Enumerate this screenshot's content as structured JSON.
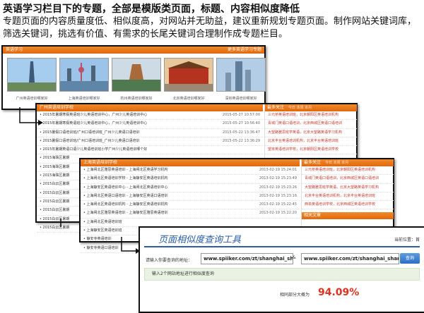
{
  "heading": "英语学习栏目下的专题，全部是模版类页面，标题、内容相似度降低",
  "description": "专题页面的内容质量度低、相似度高，对网站并无助益，建议重新规划专题页面。制作网站关键词库，筛选关键词，挑选有价值、有需求的长尾关键词合理制作成专题栏目。",
  "panel1": {
    "header": "英语学习",
    "more": "更多英语学习专题",
    "thumbs": [
      {
        "caption": "广州英语培训哪家好",
        "icon": "thumb-tower",
        "color": "#6aa8d8"
      },
      {
        "caption": "上海英语培训哪家好",
        "icon": "thumb-shanghai",
        "color": "#8ab6e0"
      },
      {
        "caption": "杭州英语培训哪家好",
        "icon": "thumb-pagoda",
        "color": "#9fb7cf"
      },
      {
        "caption": "北京英语培训哪家好",
        "icon": "thumb-tiananmen",
        "color": "#c24b2b"
      },
      {
        "caption": "深圳英语培训哪家好",
        "icon": "thumb-skyline",
        "color": "#7fa3c9"
      }
    ]
  },
  "panel2": {
    "header": "广州英语培训学校",
    "items": [
      {
        "text": "• 2015年暑期寒假英语班少儿英语培训中心，广州少儿英语培训中心",
        "date": "2015-05-27 10:57:00"
      },
      {
        "text": "• 2015年暑期寒假英语班少儿英语培训中心，广州少儿英语培训中心",
        "date": "2015-05-27 10:56:40"
      },
      {
        "text": "• 2015暑假口语培训班/广州口语培训班_广州少儿英语口语培训",
        "date": "2015-05-22 13:36:47"
      },
      {
        "text": "• 2015暑假口语培训班/广州口语培训班_广州少儿英语口语培训",
        "date": "2015-05-22 13:36:29"
      },
      {
        "text": "• 2015年暑期英语口语少儿英语培训班小学广州少儿英语培训哪个好",
        "date": ""
      },
      {
        "text": "• 2015海珠区暑期",
        "date": ""
      },
      {
        "text": "• 2015海珠区暑期",
        "date": ""
      },
      {
        "text": "• 2015海珠区暑期",
        "date": ""
      },
      {
        "text": "• 2015白云区暑期",
        "date": ""
      },
      {
        "text": "• 2015白云区暑期",
        "date": ""
      },
      {
        "text": "• 2015白云区暑期",
        "date": ""
      },
      {
        "text": "• 2015白云区暑期",
        "date": ""
      },
      {
        "text": "• 2015白云区暑期",
        "date": ""
      },
      {
        "text": "• 2015白云区暑期",
        "date": ""
      }
    ],
    "side_header": "最多关注",
    "side_tabs": "今日  本周  本月",
    "side_items": [
      "三元桥英语培训班，北京朝阳区英语培训机构",
      "青城门英语口语培训，北京西城区英语口语培训",
      "大望路雅思班学英语，北京大望路英语学习机构",
      "北京丰台英语培训机构，北京丰台英语培训班",
      "望京英语培训学校，北京朝阳区英语培训学校"
    ]
  },
  "panel3": {
    "header": "上海英语培训学校",
    "items": [
      {
        "text": "• 上海闸北区雅思英语培训 - 上海闸北区英语学习机构",
        "date": "2013-02-19 15:24:01"
      },
      {
        "text": "• 上海闸北区英语培训学校 - 上海静安区英语培训机构",
        "date": "2013-02-19 15:23:49"
      },
      {
        "text": "• 上海静安区英语培训中心 - 上海闸北区英语培训中心",
        "date": "2013-02-19 15:23:26"
      },
      {
        "text": "• 上海闸北区英语口语培训 - 上海静安区英语口语培训",
        "date": "2013-02-19 15:23:16"
      },
      {
        "text": "• 上海闸北区英语培训机构 - 上海静安区英语培训机构",
        "date": "2013-02-19 15:22:45"
      },
      {
        "text": "• 上海闸北区雅思英语培训 - 上海静安区雅思英语培训",
        "date": "2013-02-19 15:22:20"
      },
      {
        "text": "• 上海闸北区英语培训班",
        "date": ""
      },
      {
        "text": "• 上海静安区英语培训班",
        "date": ""
      },
      {
        "text": "• 静安寺英语培训",
        "date": ""
      },
      {
        "text": "• 静安寺英语口语培训",
        "date": ""
      }
    ],
    "side_header": "最多关注",
    "side_tabs": "今日  本周  本月",
    "side_items": [
      "三元桥英语培训班，北京朝阳区英语培训机构",
      "青城门英语口语培训，北京西城区英语口语培训",
      "大望路雅思班学英语，北京大望路英语学习机构",
      "北京丰台英语培训机构，北京丰台英语培训班",
      "西单英语培训学校，北京西城区英语培训学校"
    ],
    "side_footer": "相关文章"
  },
  "tool": {
    "title": "页面相似度查询工具",
    "location": "当前位置：首",
    "label": "请输入你要查询的地址：",
    "url1": "www.spiiker.com/zt/shanghai_shang",
    "url2": "www.spiiker.com/zt/shanghai_shang",
    "amp": "&",
    "button": "查询",
    "note": "输入2个网站地址进行相似度查询",
    "result_label": "相同部分大概为",
    "result_value": "94.09%"
  }
}
